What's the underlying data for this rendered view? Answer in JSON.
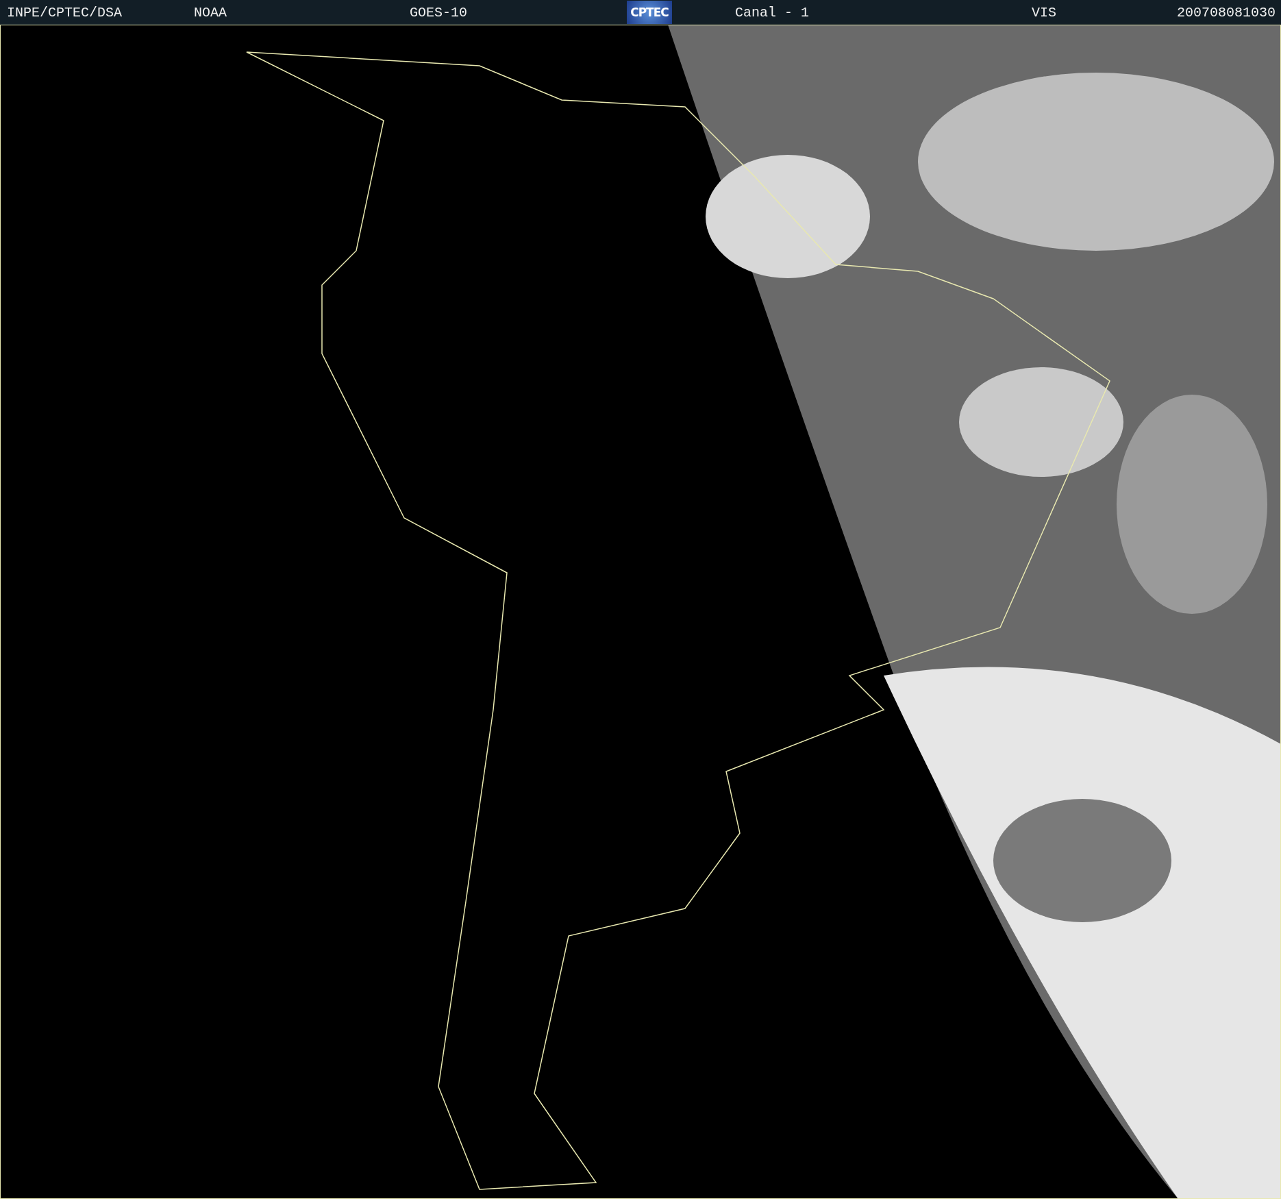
{
  "header": {
    "source": "INPE/CPTEC/DSA",
    "agency": "NOAA",
    "satellite": "GOES-10",
    "logo": "CPTEC",
    "channel": "Canal - 1",
    "band": "VIS",
    "timestamp": "200708081030"
  }
}
